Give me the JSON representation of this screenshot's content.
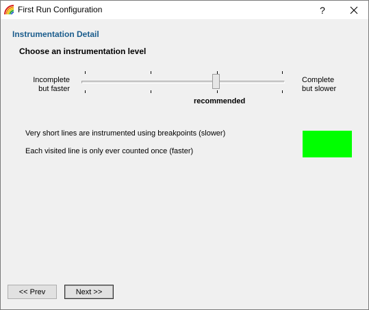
{
  "window": {
    "title": "First Run Configuration",
    "help_glyph": "?",
    "close_icon": "close-icon"
  },
  "page": {
    "section_title": "Instrumentation Detail",
    "heading": "Choose an instrumentation level"
  },
  "slider": {
    "left_label_line1": "Incomplete",
    "left_label_line2": "but faster",
    "right_label_line1": "Complete",
    "right_label_line2": "but slower",
    "marker_label": "recommended",
    "tick_count": 4,
    "selected_index": 2
  },
  "description": {
    "line1": "Very short lines are instrumented using breakpoints (slower)",
    "line2": "Each visited line is only ever counted once (faster)",
    "indicator_color": "#00ff00"
  },
  "buttons": {
    "prev": "<< Prev",
    "next": "Next >>"
  }
}
